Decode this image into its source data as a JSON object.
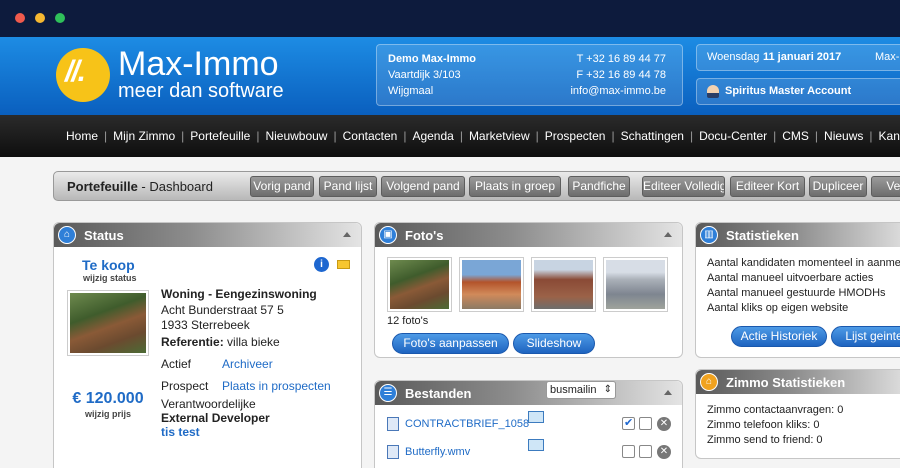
{
  "brand": {
    "name": "Max-Immo",
    "tagline": "meer dan software",
    "logo_text": "//."
  },
  "contact": {
    "company": "Demo Max-Immo",
    "street": "Vaartdijk 3/103",
    "city": "Wijgmaal",
    "phone": "T +32 16 89 44 77",
    "fax": "F +32 16 89 44 78",
    "email": "info@max-immo.be"
  },
  "date_box": {
    "weekday": "Woensdag",
    "date": "11 januari 2017",
    "extra": "Max-",
    "account": "Spiritus Master Account"
  },
  "nav": [
    "Home",
    "Mijn Zimmo",
    "Portefeuille",
    "Nieuwbouw",
    "Contacten",
    "Agenda",
    "Marketview",
    "Prospecten",
    "Schattingen",
    "Docu-Center",
    "CMS",
    "Nieuws",
    "Kantoor"
  ],
  "toolbar": {
    "title": "Portefeuille",
    "subtitle": " - Dashboard",
    "buttons": [
      "Vorig pand",
      "Pand lijst",
      "Volgend pand",
      "Plaats in groep",
      "Pandfiche",
      "Editeer Volledig",
      "Editeer Kort",
      "Dupliceer",
      "Verwi"
    ]
  },
  "status": {
    "title": "Status",
    "state": "Te koop",
    "change": "wijzig status",
    "type": "Woning - Eengezinswoning",
    "address1": "Acht Bunderstraat 57 5",
    "address2": "1933 Sterrebeek",
    "ref_label": "Referentie:",
    "ref_value": "villa bieke",
    "actief_label": "Actief",
    "actief_value": "Archiveer",
    "prospect_label": "Prospect",
    "prospect_value": "Plaats in prospecten",
    "verantw_label": "Verantwoordelijke",
    "verantw_value": "External Developer",
    "tis_test": "tis test",
    "price": "€ 120.000",
    "price_change": "wijzig prijs"
  },
  "fotos": {
    "title": "Foto's",
    "count": "12 foto's",
    "btn_edit": "Foto's aanpassen",
    "btn_slideshow": "Slideshow"
  },
  "bestanden": {
    "title": "Bestanden",
    "files": [
      {
        "name": "CONTRACTBRIEF_1058",
        "select": ""
      },
      {
        "name": "Butterfly.wmv",
        "select": "busmailin"
      }
    ]
  },
  "statistieken": {
    "title": "Statistieken",
    "lines": [
      "Aantal kandidaten momenteel in aanme",
      "Aantal manueel uitvoerbare acties",
      "Aantal manueel gestuurde HMODHs",
      "Aantal kliks op eigen website"
    ],
    "btn_history": "Actie Historiek",
    "btn_list": "Lijst geinter"
  },
  "zimmo": {
    "title": "Zimmo Statistieken",
    "lines": [
      "Zimmo contactaanvragen: 0",
      "Zimmo telefoon kliks: 0",
      "Zimmo send to friend: 0"
    ]
  }
}
